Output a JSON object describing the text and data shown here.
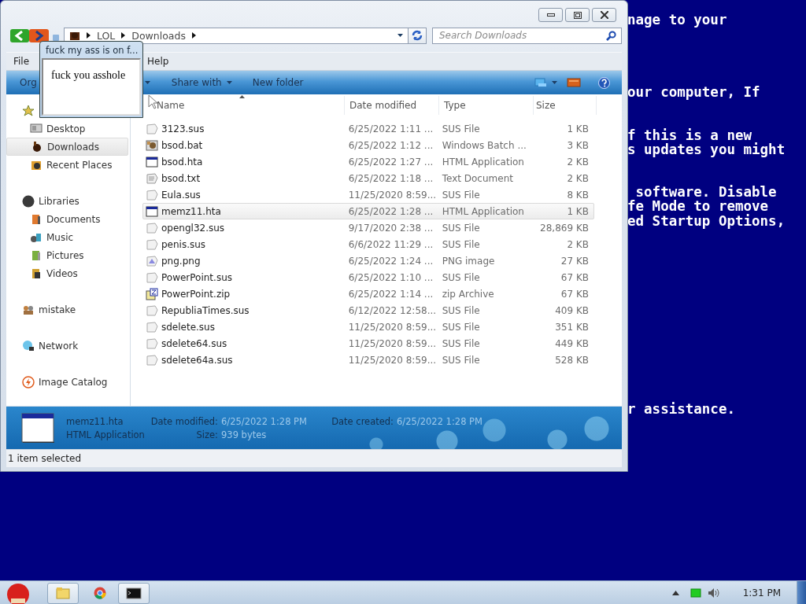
{
  "bsod_text": [
    {
      "lines": [
        "nage to your"
      ]
    },
    {
      "lines": [
        "our computer, If"
      ]
    },
    {
      "lines": [
        "f this is a new",
        "s updates you might"
      ]
    },
    {
      "lines": [
        " software. Disable",
        "fe Mode to remove",
        "ed Startup Options,"
      ]
    },
    {
      "lines": [
        "r assistance."
      ]
    }
  ],
  "explorer": {
    "address": {
      "crumbs": [
        "LOL",
        "Downloads"
      ]
    },
    "search": {
      "placeholder": "Search Downloads"
    },
    "menu": [
      "File",
      "Help"
    ],
    "commands": [
      {
        "label": "Org",
        "dropdown": false
      },
      {
        "label": "Share with",
        "dropdown": true
      },
      {
        "label": "New folder",
        "dropdown": false
      }
    ],
    "nav": [
      {
        "kind": "star",
        "children": [
          {
            "label": "Desktop",
            "kind": "desktop",
            "selected": false
          },
          {
            "label": "Downloads",
            "kind": "downloads",
            "selected": true
          },
          {
            "label": "Recent Places",
            "kind": "recent",
            "selected": false
          }
        ]
      },
      {
        "label": "Libraries",
        "kind": "library",
        "selected": false,
        "children": [
          {
            "label": "Documents",
            "kind": "documents",
            "selected": false
          },
          {
            "label": "Music",
            "kind": "music",
            "selected": false
          },
          {
            "label": "Pictures",
            "kind": "pictures",
            "selected": false
          },
          {
            "label": "Videos",
            "kind": "videos",
            "selected": false
          }
        ]
      },
      {
        "label": "mistake",
        "kind": "people",
        "selected": false
      },
      {
        "label": "Network",
        "kind": "network",
        "selected": false
      },
      {
        "label": "Image Catalog",
        "kind": "catalog",
        "selected": false
      }
    ],
    "columns": [
      "Name",
      "Date modified",
      "Type",
      "Size"
    ],
    "rows": [
      {
        "name": "3123.sus",
        "date": "6/25/2022 1:11 ...",
        "type": "SUS File",
        "size": "1 KB",
        "kind": "generic",
        "selected": false
      },
      {
        "name": "bsod.bat",
        "date": "6/25/2022 1:12 ...",
        "type": "Windows Batch ...",
        "size": "3 KB",
        "kind": "batch",
        "selected": false
      },
      {
        "name": "bsod.hta",
        "date": "6/25/2022 1:27 ...",
        "type": "HTML Application",
        "size": "2 KB",
        "kind": "window",
        "selected": false
      },
      {
        "name": "bsod.txt",
        "date": "6/25/2022 1:18 ...",
        "type": "Text Document",
        "size": "2 KB",
        "kind": "text",
        "selected": false
      },
      {
        "name": "Eula.sus",
        "date": "11/25/2020 8:59...",
        "type": "SUS File",
        "size": "8 KB",
        "kind": "generic",
        "selected": false
      },
      {
        "name": "memz11.hta",
        "date": "6/25/2022 1:28 ...",
        "type": "HTML Application",
        "size": "1 KB",
        "kind": "window",
        "selected": true
      },
      {
        "name": "opengl32.sus",
        "date": "9/17/2020 2:38 ...",
        "type": "SUS File",
        "size": "28,869 KB",
        "kind": "generic",
        "selected": false
      },
      {
        "name": "penis.sus",
        "date": "6/6/2022 11:29 ...",
        "type": "SUS File",
        "size": "2 KB",
        "kind": "generic",
        "selected": false
      },
      {
        "name": "png.png",
        "date": "6/25/2022 1:24 ...",
        "type": "PNG image",
        "size": "27 KB",
        "kind": "image",
        "selected": false
      },
      {
        "name": "PowerPoint.sus",
        "date": "6/25/2022 1:10 ...",
        "type": "SUS File",
        "size": "67 KB",
        "kind": "generic",
        "selected": false
      },
      {
        "name": "PowerPoint.zip",
        "date": "6/25/2022 1:14 ...",
        "type": "zip Archive",
        "size": "67 KB",
        "kind": "archive",
        "selected": false
      },
      {
        "name": "RepubliaTimes.sus",
        "date": "6/12/2022 12:58...",
        "type": "SUS File",
        "size": "409 KB",
        "kind": "generic",
        "selected": false
      },
      {
        "name": "sdelete.sus",
        "date": "11/25/2020 8:59...",
        "type": "SUS File",
        "size": "351 KB",
        "kind": "generic",
        "selected": false
      },
      {
        "name": "sdelete64.sus",
        "date": "11/25/2020 8:59...",
        "type": "SUS File",
        "size": "449 KB",
        "kind": "generic",
        "selected": false
      },
      {
        "name": "sdelete64a.sus",
        "date": "11/25/2020 8:59...",
        "type": "SUS File",
        "size": "528 KB",
        "kind": "generic",
        "selected": false
      }
    ],
    "details": {
      "name": "memz11.hta",
      "type": "HTML Application",
      "modified_label": "Date modified:",
      "modified": "6/25/2022 1:28 PM",
      "created_label": "Date created:",
      "created": "6/25/2022 1:28 PM",
      "size_label": "Size:",
      "size": "939 bytes"
    },
    "status": "1 item selected"
  },
  "popup": {
    "title": "fuck my ass is on f...",
    "message": "fuck you asshole"
  },
  "taskbar": {
    "clock": "1:31 PM"
  }
}
